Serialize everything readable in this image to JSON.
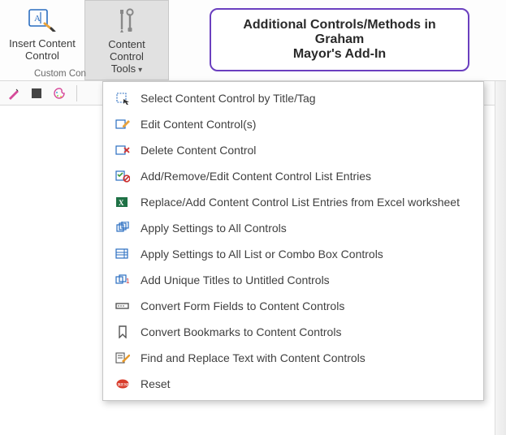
{
  "ribbon": {
    "insert_label_l1": "Insert Content",
    "insert_label_l2": "Control",
    "tools_label_l1": "Content Control",
    "tools_label_l2": "Tools",
    "group_label": "Custom Con"
  },
  "callout": {
    "line1": "Additional Controls/Methods in Graham",
    "line2": "Mayor's Add-In"
  },
  "menu": {
    "items": [
      "Select Content Control by Title/Tag",
      "Edit Content Control(s)",
      "Delete Content Control",
      "Add/Remove/Edit Content Control List Entries",
      "Replace/Add Content Control List Entries from Excel worksheet",
      "Apply Settings to All Controls",
      "Apply Settings to All List or Combo Box Controls",
      "Add Unique Titles to Untitled Controls",
      "Convert Form Fields to Content Controls",
      "Convert Bookmarks to Content Controls",
      "Find and Replace Text with Content Controls",
      "Reset"
    ]
  }
}
